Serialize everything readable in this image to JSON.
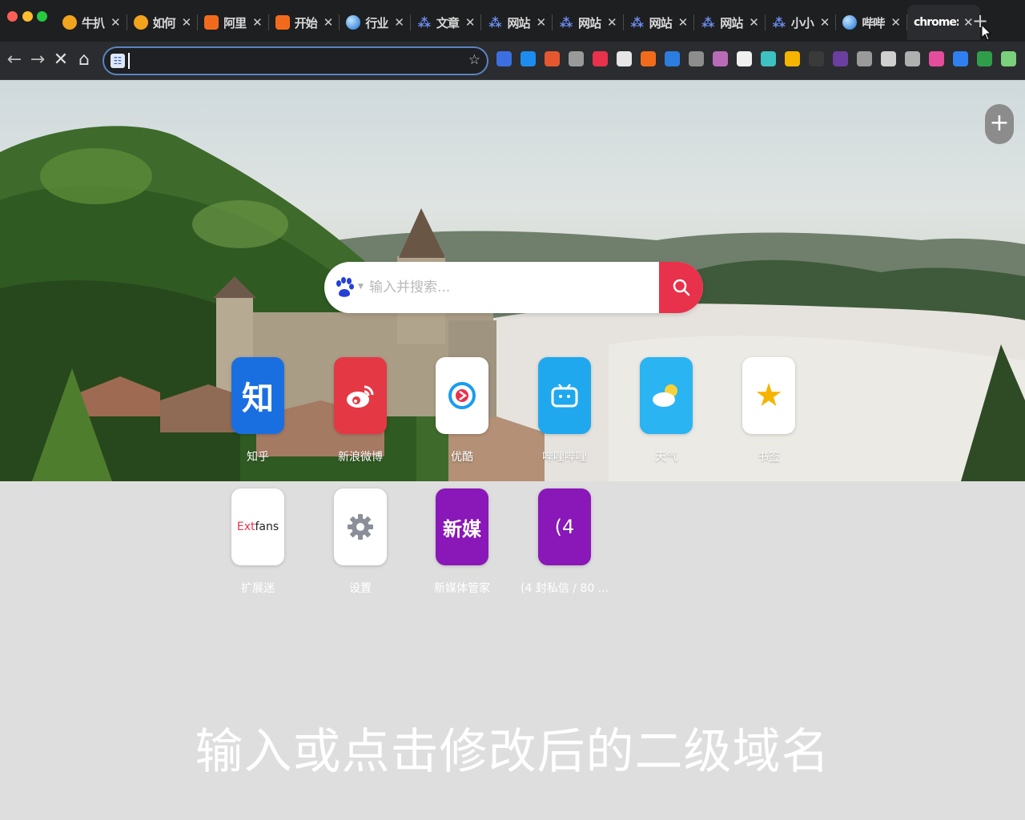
{
  "window": {
    "traffic_lights": [
      "close",
      "minimize",
      "zoom"
    ]
  },
  "tabs": [
    {
      "title": "牛扒",
      "favicon": "sun-icon",
      "close": "✕"
    },
    {
      "title": "如何",
      "favicon": "sun-icon",
      "close": "✕"
    },
    {
      "title": "阿里",
      "favicon": "bracket-icon",
      "close": "✕"
    },
    {
      "title": "开始",
      "favicon": "bracket-icon",
      "close": "✕"
    },
    {
      "title": "行业",
      "favicon": "globe-icon",
      "close": "✕"
    },
    {
      "title": "文章",
      "favicon": "dots-icon",
      "close": "✕"
    },
    {
      "title": "网站",
      "favicon": "dots-icon",
      "close": "✕"
    },
    {
      "title": "网站",
      "favicon": "dots-icon",
      "close": "✕"
    },
    {
      "title": "网站",
      "favicon": "dots-icon",
      "close": "✕"
    },
    {
      "title": "网站",
      "favicon": "dots-icon",
      "close": "✕"
    },
    {
      "title": "小小",
      "favicon": "dots-icon",
      "close": "✕"
    },
    {
      "title": "哔哔",
      "favicon": "globe-icon",
      "close": "✕"
    },
    {
      "title": "chrome:",
      "favicon": "",
      "close": "✕",
      "active": true
    }
  ],
  "new_tab": "+",
  "toolbar": {
    "back": "←",
    "forward": "→",
    "stop": "✕",
    "home": "⌂",
    "address_value": "",
    "star": "☆"
  },
  "extensions": [
    "#3b6fe0",
    "#1d8cf0",
    "#e5572f",
    "#9a9a9a",
    "#e8314b",
    "#e6e6e6",
    "#f26b1d",
    "#2d7de0",
    "#8d8d8d",
    "#b86bb7",
    "#f0f0f0",
    "#3ec1c1",
    "#f5b400",
    "#3a3a3a",
    "#6b3fa0",
    "#9a9a9a",
    "#cfcfcf",
    "#b0b0b0",
    "#e44d9c",
    "#2f7ff0",
    "#2f9e4a",
    "#7bd17b"
  ],
  "page": {
    "add_button": "+",
    "search": {
      "placeholder": "输入并搜索...",
      "engine_icon": "baidu-paw-icon"
    },
    "tiles": [
      {
        "label": "知乎",
        "icon_text": "知",
        "bg": "#1a6fe0",
        "fg": "#ffffff"
      },
      {
        "label": "新浪微博",
        "icon_text": "",
        "bg": "#e53845",
        "fg": "#ffffff"
      },
      {
        "label": "优酷",
        "icon_text": "",
        "bg": "#ffffff",
        "fg": "#1a9cf0"
      },
      {
        "label": "哔哩哔哩",
        "icon_text": "",
        "bg": "#1fa8ee",
        "fg": "#ffffff"
      },
      {
        "label": "天气",
        "icon_text": "",
        "bg": "#2ab4f2",
        "fg": "#ffffff"
      },
      {
        "label": "书签",
        "icon_text": "★",
        "bg": "#ffffff",
        "fg": "#f5b400"
      },
      {
        "label": "扩展迷",
        "icon_text": "Extfans",
        "bg": "#ffffff",
        "fg": "#222222"
      },
      {
        "label": "设置",
        "icon_text": "",
        "bg": "#ffffff",
        "fg": "#8a8f99"
      },
      {
        "label": "新媒体管家",
        "icon_text": "新媒",
        "bg": "#8a17b8",
        "fg": "#ffffff"
      },
      {
        "label": "(4 封私信 / 80 ...",
        "icon_text": "(4",
        "bg": "#8a17b8",
        "fg": "#ffffff"
      }
    ]
  },
  "subtitle": "输入或点击修改后的二级域名"
}
